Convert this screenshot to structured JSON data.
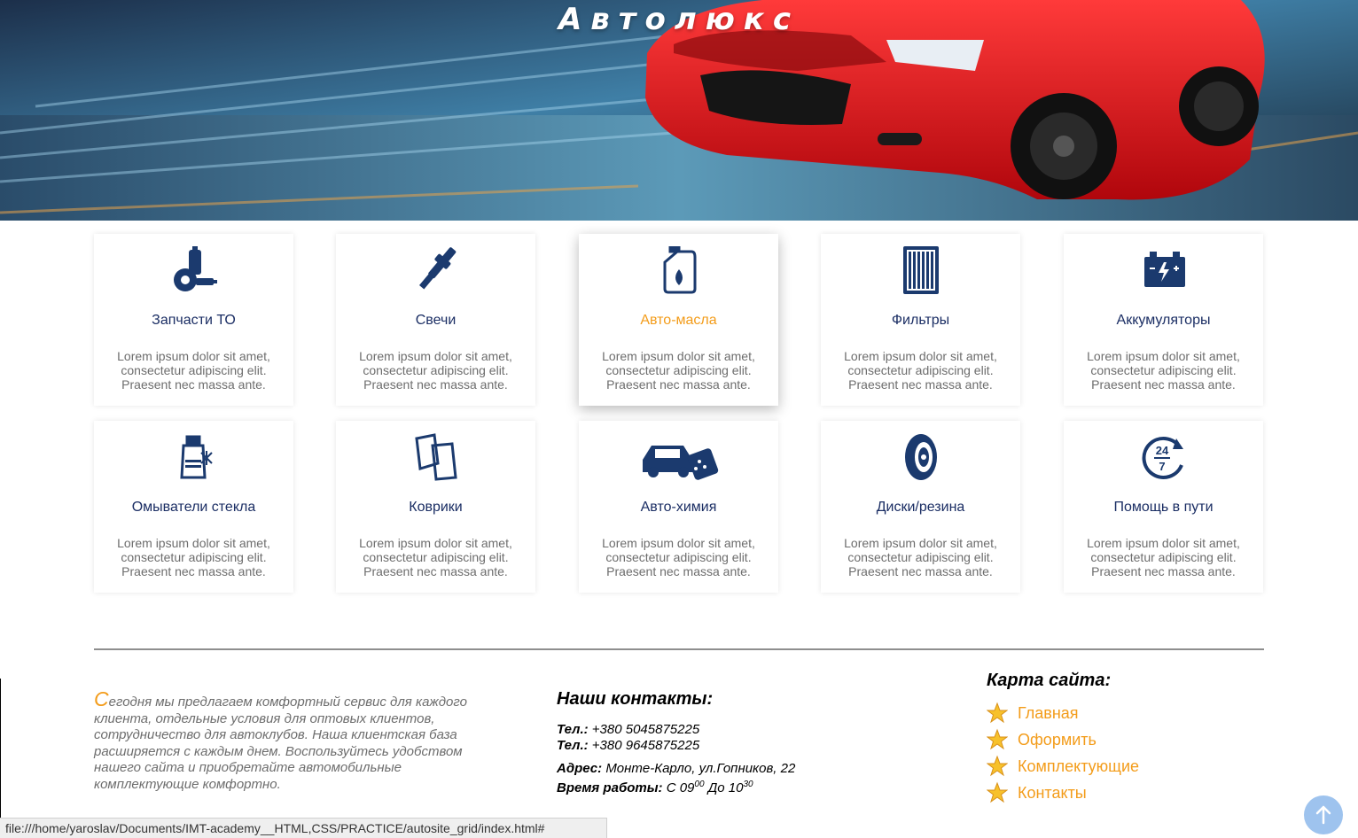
{
  "hero": {
    "title": "Автолюкс"
  },
  "cards": [
    {
      "icon": "parts-icon",
      "title": "Запчасти ТО",
      "text": "Lorem ipsum dolor sit amet, consectetur adipiscing elit. Praesent nec massa ante.",
      "active": false
    },
    {
      "icon": "spark-plug-icon",
      "title": "Свечи",
      "text": "Lorem ipsum dolor sit amet, consectetur adipiscing elit. Praesent nec massa ante.",
      "active": false
    },
    {
      "icon": "oil-canister-icon",
      "title": "Авто-масла",
      "text": "Lorem ipsum dolor sit amet, consectetur adipiscing elit. Praesent nec massa ante.",
      "active": true
    },
    {
      "icon": "filter-icon",
      "title": "Фильтры",
      "text": "Lorem ipsum dolor sit amet, consectetur adipiscing elit. Praesent nec massa ante.",
      "active": false
    },
    {
      "icon": "battery-icon",
      "title": "Аккумуляторы",
      "text": "Lorem ipsum dolor sit amet, consectetur adipiscing elit. Praesent nec massa ante.",
      "active": false
    },
    {
      "icon": "washer-fluid-icon",
      "title": "Омыватели стекла",
      "text": "Lorem ipsum dolor sit amet, consectetur adipiscing elit. Praesent nec massa ante.",
      "active": false
    },
    {
      "icon": "car-mats-icon",
      "title": "Коврики",
      "text": "Lorem ipsum dolor sit amet, consectetur adipiscing elit. Praesent nec massa ante.",
      "active": false
    },
    {
      "icon": "car-wash-icon",
      "title": "Авто-химия",
      "text": "Lorem ipsum dolor sit amet, consectetur adipiscing elit. Praesent nec massa ante.",
      "active": false
    },
    {
      "icon": "tire-icon",
      "title": "Диски/резина",
      "text": "Lorem ipsum dolor sit amet, consectetur adipiscing elit. Praesent nec massa ante.",
      "active": false
    },
    {
      "icon": "support-24-7-icon",
      "title": "Помощь в пути",
      "text": "Lorem ipsum dolor sit amet, consectetur adipiscing elit. Praesent nec massa ante.",
      "active": false
    }
  ],
  "about": {
    "drop": "С",
    "text": "егодня мы предлагаем комфортный сервис для каждого клиента, отдельные условия для оптовых клиентов, сотрудничество для автоклубов. Наша клиентская база расширяется с каждым днем. Воспользуйтесь удобством нашего сайта и приобретайте автомобильные комплектующие комфортно."
  },
  "contacts": {
    "heading": "Наши контакты:",
    "phone_label": "Тел.:",
    "phone1": "+380 5045875225",
    "phone2": "+380 9645875225",
    "address_label": "Адрес:",
    "address": "Монте-Карло, ул.Гопников, 22",
    "hours_label": "Время работы:",
    "hours_from": "С 09",
    "hours_from_sup": "00",
    "hours_to": "До 10",
    "hours_to_sup": "30"
  },
  "sitemap": {
    "heading": "Карта сайта:",
    "links": [
      "Главная",
      "Оформить",
      "Комплектующие",
      "Контакты"
    ]
  },
  "statusbar": {
    "url": "file:///home/yaroslav/Documents/IMT-academy__HTML,CSS/PRACTICE/autosite_grid/index.html#"
  },
  "colors": {
    "accent": "#f39c1a",
    "navy": "#1b2e64",
    "muted": "#6d6d6d"
  }
}
